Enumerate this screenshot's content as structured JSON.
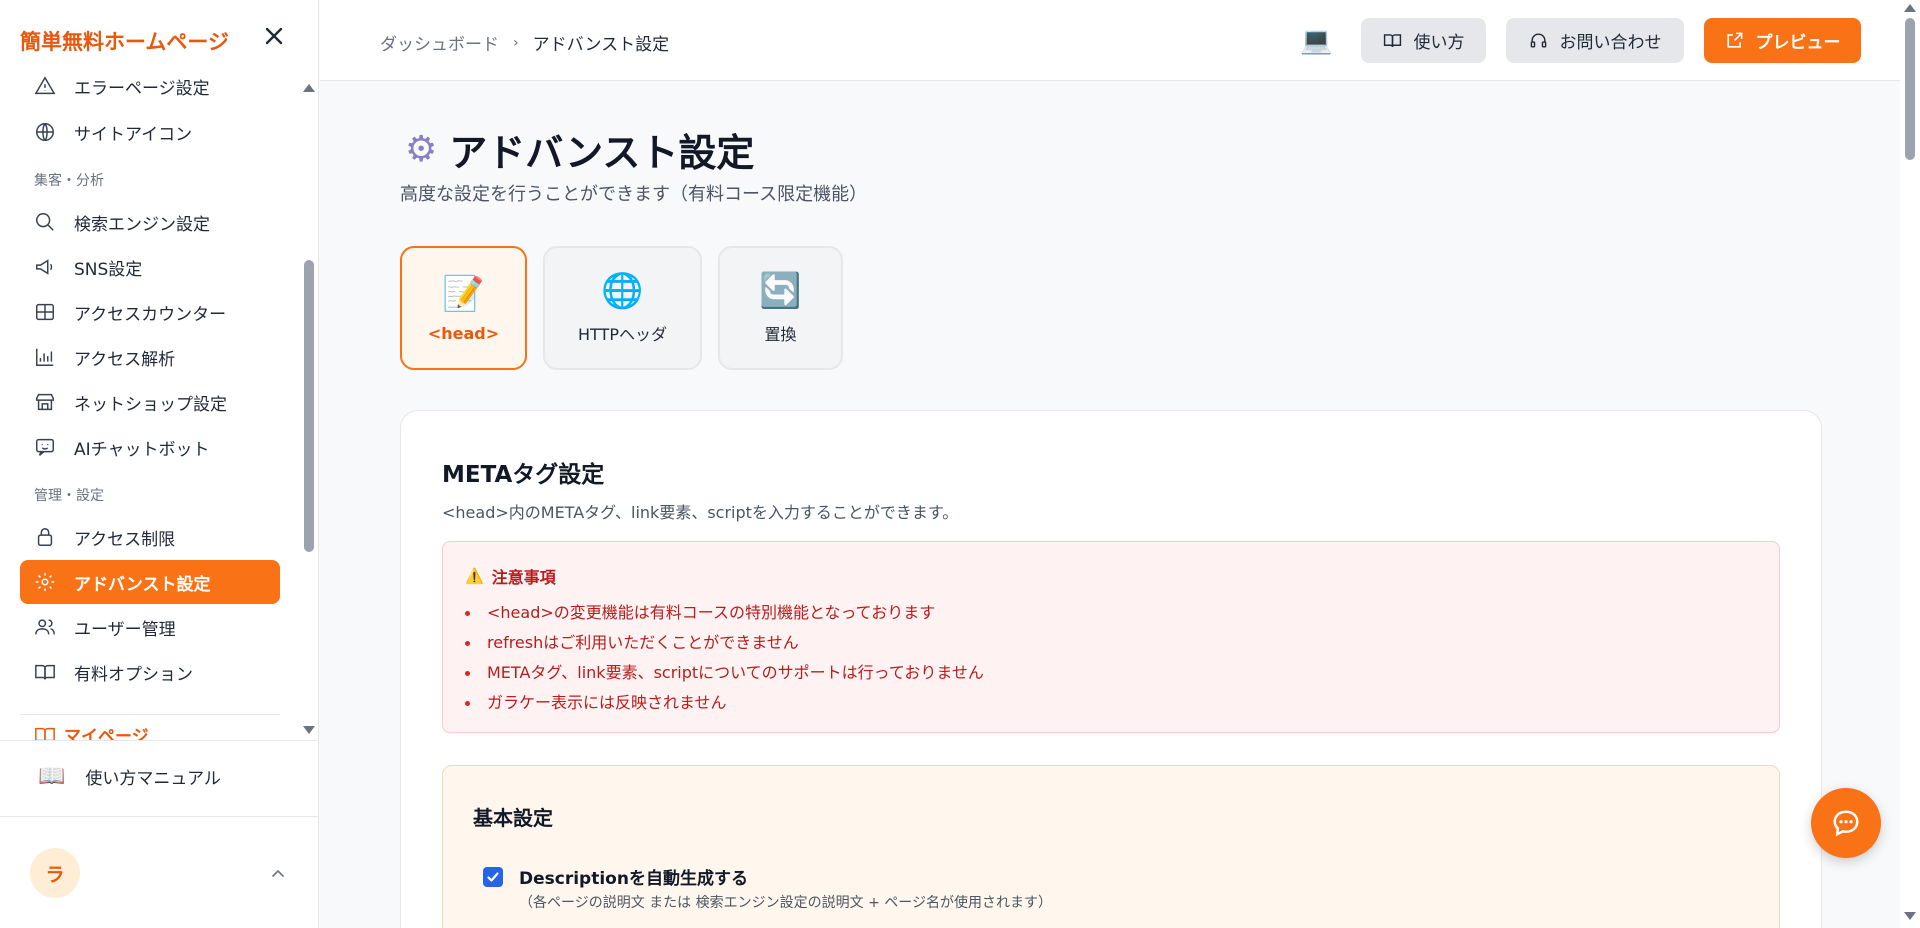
{
  "sidebar": {
    "brand": "簡単無料ホームページ",
    "sections": {
      "analytics": "集客・分析",
      "management": "管理・設定"
    },
    "items": {
      "error_page": "エラーページ設定",
      "site_icon": "サイトアイコン",
      "seo": "検索エンジン設定",
      "sns": "SNS設定",
      "counter": "アクセスカウンター",
      "analysis": "アクセス解析",
      "shop": "ネットショップ設定",
      "chatbot": "AIチャットボット",
      "access_limit": "アクセス制限",
      "advanced": "アドバンスト設定",
      "users": "ユーザー管理",
      "options": "有料オプション"
    },
    "mypage": "マイページ",
    "manual": "使い方マニュアル",
    "avatar_initial": "ラ"
  },
  "header": {
    "breadcrumb": {
      "parent": "ダッシュボード",
      "current": "アドバンスト設定"
    },
    "buttons": {
      "howto": "使い方",
      "contact": "お問い合わせ",
      "preview": "プレビュー"
    }
  },
  "page": {
    "title": "アドバンスト設定",
    "subtitle": "高度な設定を行うことができます（有料コース限定機能）"
  },
  "tabs": [
    {
      "label": "<head>",
      "icon": "memo-icon",
      "active": true
    },
    {
      "label": "HTTPヘッダ",
      "icon": "globe-icon",
      "active": false
    },
    {
      "label": "置換",
      "icon": "refresh-icon",
      "active": false
    }
  ],
  "meta_card": {
    "title": "METAタグ設定",
    "description": "<head>内のMETAタグ、link要素、scriptを入力することができます。",
    "warning": {
      "title": "注意事項",
      "items": [
        "<head>の変更機能は有料コースの特別機能となっております",
        "refreshはご利用いただくことができません",
        "METAタグ、link要素、scriptについてのサポートは行っておりません",
        "ガラケー表示には反映されません"
      ]
    },
    "basic": {
      "title": "基本設定",
      "auto_description_label": "Descriptionを自動生成する",
      "auto_description_checked": true,
      "auto_description_note": "（各ページの説明文 または 検索エンジン設定の説明文 + ページ名が使用されます）"
    }
  },
  "colors": {
    "accent": "#f97316",
    "brand": "#ea580c",
    "warning_text": "#b91c1c",
    "checkbox": "#2563eb"
  }
}
